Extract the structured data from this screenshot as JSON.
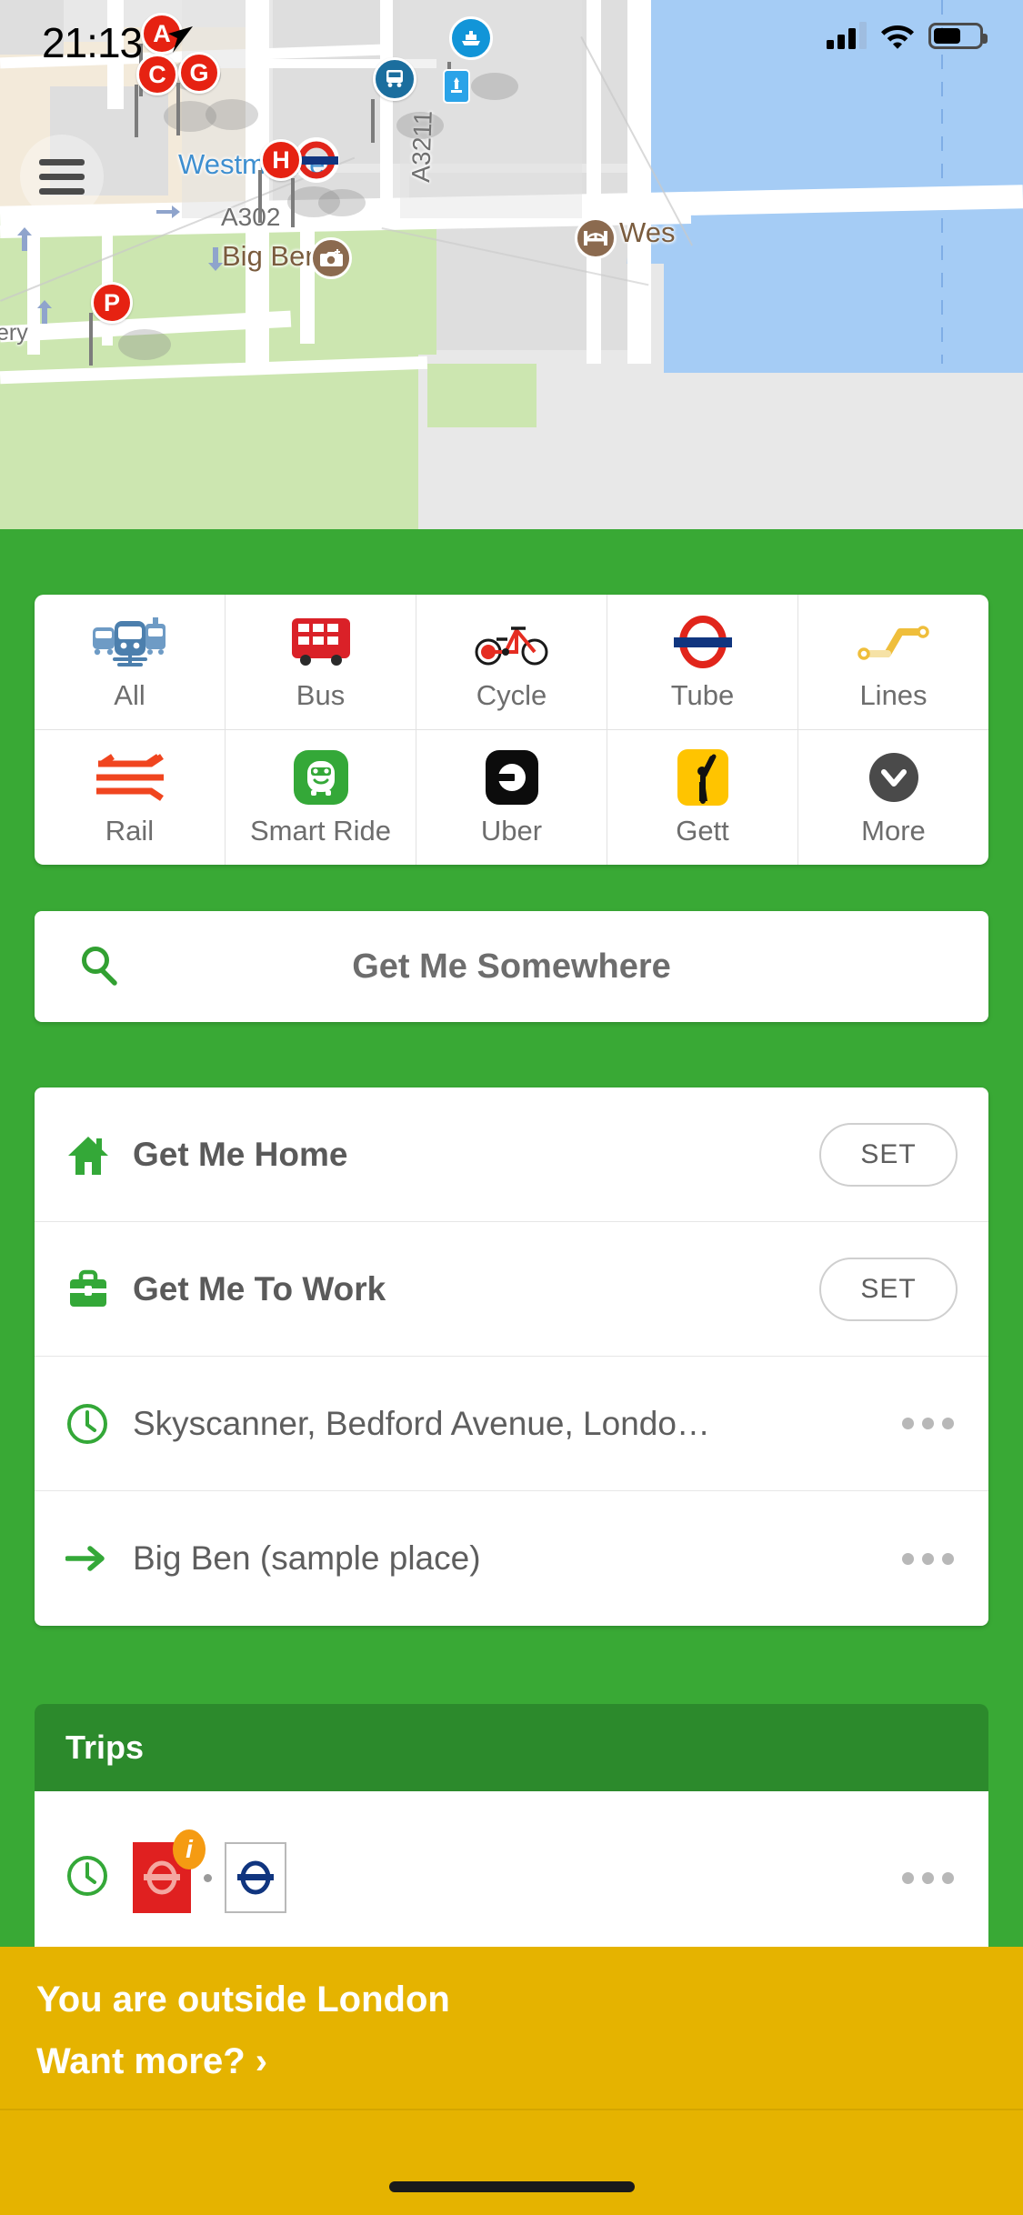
{
  "status_bar": {
    "time": "21:13",
    "location_arrow": "location-arrow-icon",
    "signal": "signal-bars-icon",
    "wifi": "wifi-icon",
    "battery": "battery-icon"
  },
  "map": {
    "menu_button": "hamburger-menu-icon",
    "labels": [
      {
        "text": "Westminster",
        "kind": "blue"
      },
      {
        "text": "A302",
        "kind": "road"
      },
      {
        "text": "A3211",
        "kind": "road"
      },
      {
        "text": "Big Ben",
        "kind": "poi"
      },
      {
        "text": "Wes",
        "kind": "poi"
      },
      {
        "text": "ery",
        "kind": "road"
      }
    ],
    "pins": [
      {
        "label": "A"
      },
      {
        "label": "C"
      },
      {
        "label": "G"
      },
      {
        "label": "H"
      },
      {
        "label": "P"
      }
    ],
    "other_markers": [
      "tube-roundel-pin",
      "bus-stop-pin",
      "river-boat-pin",
      "pier-marker",
      "big-ben-camera-poi",
      "westminster-bridge-poi"
    ]
  },
  "modes": {
    "row1": [
      {
        "label": "All",
        "icon": "all-transport-icon"
      },
      {
        "label": "Bus",
        "icon": "bus-icon"
      },
      {
        "label": "Cycle",
        "icon": "bicycle-icon"
      },
      {
        "label": "Tube",
        "icon": "tube-roundel-icon"
      },
      {
        "label": "Lines",
        "icon": "lines-route-icon"
      }
    ],
    "row2": [
      {
        "label": "Rail",
        "icon": "national-rail-icon"
      },
      {
        "label": "Smart Ride",
        "icon": "smart-ride-icon"
      },
      {
        "label": "Uber",
        "icon": "uber-icon"
      },
      {
        "label": "Gett",
        "icon": "gett-icon"
      },
      {
        "label": "More",
        "icon": "chevron-down-icon"
      }
    ]
  },
  "search": {
    "placeholder": "Get Me Somewhere",
    "icon": "search-icon"
  },
  "favourites": [
    {
      "label": "Get Me Home",
      "icon": "home-icon",
      "action": "SET",
      "bold": true
    },
    {
      "label": "Get Me To Work",
      "icon": "briefcase-icon",
      "action": "SET",
      "bold": true
    },
    {
      "label": "Skyscanner, Bedford Avenue, Londo…",
      "icon": "clock-icon",
      "action": "more",
      "bold": false
    },
    {
      "label": "Big Ben (sample place)",
      "icon": "arrow-right-icon",
      "action": "more",
      "bold": false
    }
  ],
  "trips": {
    "title": "Trips",
    "row": {
      "icon": "clock-icon",
      "badges": [
        "bus-route-badge",
        "tube-badge"
      ],
      "info_badge": "i",
      "action": "more"
    }
  },
  "banner": {
    "line1": "You are outside London",
    "line2": "Want more? ›"
  },
  "colors": {
    "brand_green": "#39A935",
    "banner_yellow": "#E5B300",
    "pin_red": "#E62212",
    "tube_blue": "#10357F",
    "tube_red": "#E1251B"
  }
}
